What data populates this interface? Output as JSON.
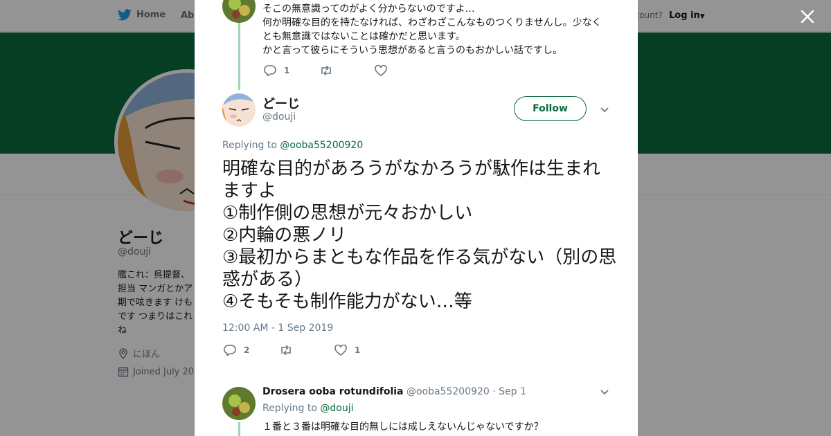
{
  "topnav": {
    "home_label": "Home",
    "about_label": "Abo",
    "account_prompt": "ccount?",
    "login_label": "Log in"
  },
  "profile": {
    "name": "どーじ",
    "handle": "@douji",
    "bio": "艦これ：呉提督、担当 マンガとかア期で呟きます けもです つまりはこれね",
    "location": "にほん",
    "joined": "Joined July 20"
  },
  "thread": {
    "previous_tweet": {
      "lines": [
        "そこの無意識ってのがよく分からないのですよ…",
        "何か明確な目的を持たなければ、わざわざこんなものつくりませんし。少なく",
        "とも無意識ではないことは確かだと思います。",
        "かと言って彼らにそういう思想があると言うのもおかしい話ですし。"
      ],
      "reply_count": "1",
      "retweet_count": "",
      "like_count": ""
    },
    "main_tweet": {
      "author_name": "どーじ",
      "author_handle": "@douji",
      "follow_label": "Follow",
      "replying_prefix": "Replying to",
      "replying_mention": "@ooba55200920",
      "text": "明確な目的があろうがなかろうが駄作は生まれますよ\n①制作側の思想が元々おかしい\n②内輪の悪ノリ\n③最初からまともな作品を作る気がない（別の思惑がある）\n④そもそも制作能力がない…等",
      "timestamp": "12:00 AM - 1 Sep 2019",
      "reply_count": "2",
      "retweet_count": "",
      "like_count": "1"
    },
    "reply_tweet": {
      "author_name": "Drosera ooba rotundifolia",
      "author_handle": "@ooba55200920",
      "date": "· Sep 1",
      "replying_prefix": "Replying to",
      "replying_mention": "@douji",
      "text": "１番と３番は明確な目的無しには成しえないんじゃないですか？"
    }
  },
  "colors": {
    "accent": "#0b6b3f",
    "thread_line": "#9fd5b5",
    "muted_text": "#657786"
  }
}
